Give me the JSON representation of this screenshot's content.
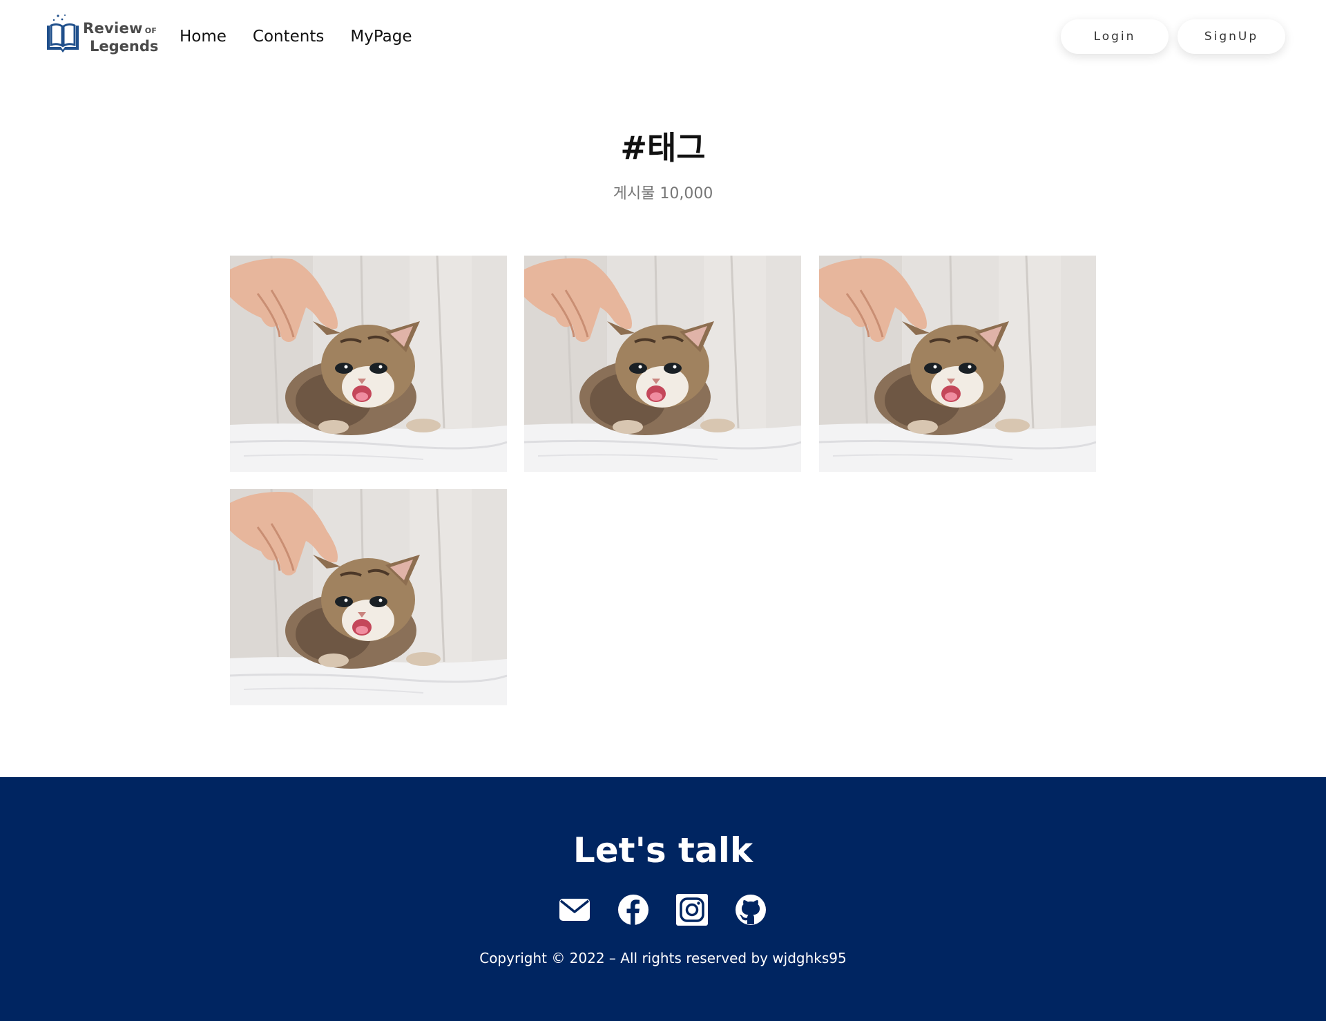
{
  "header": {
    "logo": {
      "line1": "Review",
      "of": "OF",
      "line2": "Legends"
    },
    "nav": [
      {
        "label": "Home"
      },
      {
        "label": "Contents"
      },
      {
        "label": "MyPage"
      }
    ],
    "login_label": "Login",
    "signup_label": "SignUp"
  },
  "main": {
    "title": "#태그",
    "post_count": "게시물 10,000",
    "posts": [
      {
        "image": "kitten-photo"
      },
      {
        "image": "kitten-photo"
      },
      {
        "image": "kitten-photo"
      },
      {
        "image": "kitten-photo"
      }
    ]
  },
  "footer": {
    "title": "Let's talk",
    "social": [
      "mail-icon",
      "facebook-icon",
      "instagram-icon",
      "github-icon"
    ],
    "copyright": "Copyright © 2022 – All rights reserved by wjdghks95"
  },
  "colors": {
    "footer_bg": "#002561",
    "logo_blue": "#1f4f8b"
  }
}
